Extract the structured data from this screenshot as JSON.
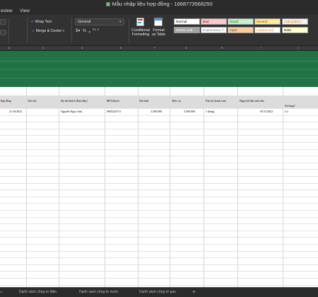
{
  "window": {
    "title": "Mẫu nhập liệu hợp đồng - 1668773568250",
    "title_icon": "document-icon"
  },
  "menu": [
    "eview",
    "Data",
    "View"
  ],
  "ribbon": {
    "wrap_text": "Wrap Text",
    "merge_center": "Merge & Center",
    "number_format": "General",
    "conditional_formatting": [
      "Conditional",
      "Formatting"
    ],
    "format_as_table": [
      "Format",
      "as Table"
    ],
    "styles": [
      {
        "label": "Normal",
        "bg": "#ffffff",
        "fg": "#000000"
      },
      {
        "label": "Bad",
        "bg": "#ffc7ce",
        "fg": "#9c0006"
      },
      {
        "label": "Good",
        "bg": "#c6efce",
        "fg": "#006100"
      },
      {
        "label": "Neutral",
        "bg": "#ffeb9c",
        "fg": "#9c5700"
      },
      {
        "label": "Calculation",
        "bg": "#f2f2f2",
        "fg": "#fa7d00"
      },
      {
        "label": "Check Cell",
        "bg": "#a5a5a5",
        "fg": "#ffffff"
      },
      {
        "label": "Explanatory T...",
        "bg": "#ffffff",
        "fg": "#7f7f7f"
      },
      {
        "label": "Input",
        "bg": "#ffcc99",
        "fg": "#3f3f76"
      },
      {
        "label": "Linked Cell",
        "bg": "#ffffff",
        "fg": "#fa7d00"
      },
      {
        "label": "Note",
        "bg": "#ffffcc",
        "fg": "#000000"
      }
    ]
  },
  "columns": [
    "B",
    "C",
    "D",
    "E",
    "F",
    "G",
    "H",
    "I",
    "J",
    "K",
    "L"
  ],
  "band_color": "#217346",
  "headers": [
    {
      "label": "hợp đồng",
      "req": "*"
    },
    {
      "label": "Ghi chú",
      "req": ""
    },
    {
      "label": "Họ tên khách (Đại diện)",
      "req": ""
    },
    {
      "label": "SĐT khách",
      "req": "*"
    },
    {
      "label": "Giá thuê",
      "req": "*"
    },
    {
      "label": "Tiền cọc",
      "req": ""
    },
    {
      "label": "Chu kỳ thanh toán",
      "req": "*"
    },
    {
      "label": "Ngày bắt đầu tính tiền",
      "req": "*"
    },
    {
      "label": "Sử dụng?",
      "req": ""
    }
  ],
  "row1": {
    "date": "21/10/2022",
    "name": "Nguyễn Ngọc Anh",
    "phone": "0905242713",
    "rent": "3.500.000",
    "deposit": "3.500.000",
    "cycle": "1 tháng",
    "start": "05/11/2022",
    "use": "Có"
  },
  "sheets": [
    "Danh sách công tơ điện",
    "Danh sách công tơ nước",
    "Danh sách công tơ gas",
    "+"
  ]
}
